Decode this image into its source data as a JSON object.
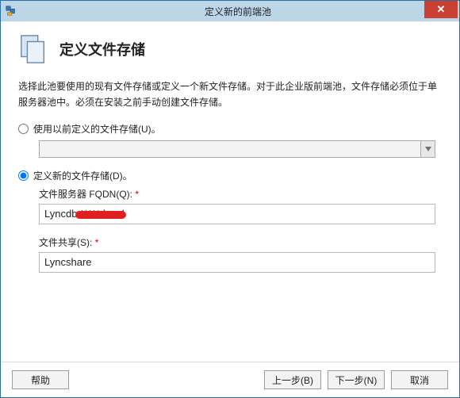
{
  "window": {
    "title": "定义新的前端池",
    "close_glyph": "✕"
  },
  "header": {
    "title": "定义文件存储"
  },
  "description": "选择此池要使用的现有文件存储或定义一个新文件存储。对于此企业版前端池，文件存储必须位于单服务器池中。必须在安装之前手动创建文件存储。",
  "options": {
    "use_existing": {
      "label": "使用以前定义的文件存储(U)。",
      "checked": false
    },
    "define_new": {
      "label": "定义新的文件存储(D)。",
      "checked": true
    }
  },
  "fields": {
    "fqdn": {
      "label": "文件服务器 FQDN(Q):",
      "required": "*",
      "value": "Lyncdb.*****.local"
    },
    "share": {
      "label": "文件共享(S):",
      "required": "*",
      "value": "Lyncshare"
    }
  },
  "buttons": {
    "help": "帮助",
    "back": "上一步(B)",
    "next": "下一步(N)",
    "cancel": "取消"
  }
}
